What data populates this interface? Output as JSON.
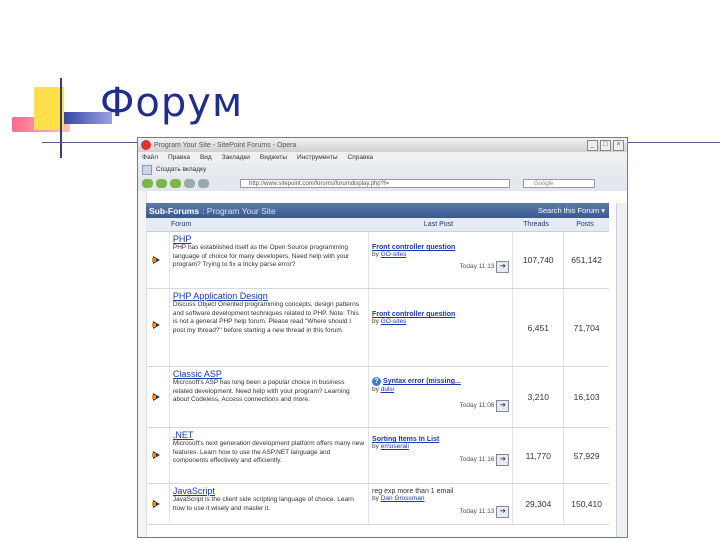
{
  "slide": {
    "title": "Форум"
  },
  "browser": {
    "window_title": "Program Your Site - SitePoint Forums - Opera",
    "menu": [
      "Файл",
      "Правка",
      "Вид",
      "Закладки",
      "Виджеты",
      "Инструменты",
      "Справка"
    ],
    "new_tab_label": "Создать вкладку",
    "address": "http://www.sitepoint.com/forums/forumdisplay.php?f=",
    "search_placeholder": "Google"
  },
  "subforums": {
    "header": "Sub-Forums",
    "section": ": Program Your Site",
    "search_label": "Search this Forum ▾",
    "columns": {
      "forum": "Forum",
      "last_post": "Last Post",
      "threads": "Threads",
      "posts": "Posts"
    },
    "rows": [
      {
        "title": "PHP",
        "description": "PHP has established itself as the Open Source programming language of choice for many developers. Need help with your program? Trying to fix a tricky parse error?",
        "last_title": "Front controller question",
        "last_by_prefix": "by",
        "last_by": "GO-sites",
        "last_time": "Today 11:13",
        "threads": "107,740",
        "posts": "651,142"
      },
      {
        "title": "PHP Application Design",
        "description": "Discuss Object Oriented programming concepts, design patterns and software development techniques related to PHP. Note: This is not a general PHP help forum. Please read \"Where should I post my thread?\" before starting a new thread in this forum.",
        "last_title": "Front controller question",
        "last_by_prefix": "by",
        "last_by": "GO-sites",
        "last_time": "Today 11:13",
        "threads": "6,451",
        "posts": "71,704"
      },
      {
        "title": "Classic ASP",
        "description": "Microsoft's ASP has long been a popular choice in business related development. Need help with your program? Learning about Codeless, Access connections and more.",
        "last_title": "Syntax error (missing...",
        "last_by_prefix": "by",
        "last_by": "dulsi",
        "last_time": "Today 11:06",
        "threads": "3,210",
        "posts": "16,103"
      },
      {
        "title": ".NET",
        "description": "Microsoft's next generation development platform offers many new features. Learn how to use the ASP.NET language and components effectively and efficiently.",
        "last_title": "Sorting Items In List",
        "last_by_prefix": "by",
        "last_by": "emuserali",
        "last_time": "Today 11:16",
        "threads": "11,770",
        "posts": "57,929"
      },
      {
        "title": "JavaScript",
        "description": "JavaScript is the client side scripting language of choice. Learn how to use it wisely and master it.",
        "last_title": "reg exp more than 1 email",
        "last_by_prefix": "by",
        "last_by": "Dan Grossman",
        "last_time": "Today 11:13",
        "threads": "29,304",
        "posts": "150,410"
      }
    ]
  }
}
